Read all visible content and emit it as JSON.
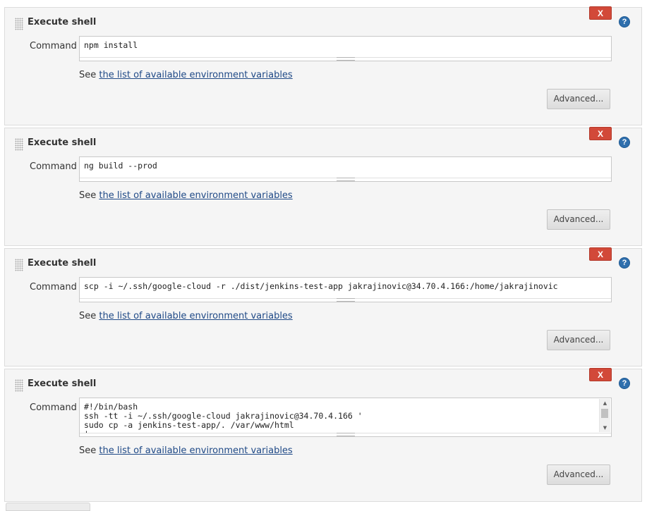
{
  "steps": [
    {
      "title": "Execute shell",
      "delete_label": "X",
      "help_label": "?",
      "command_label": "Command",
      "command_value": "npm install",
      "see_text": "See ",
      "env_link": "the list of available environment variables",
      "advanced_label": "Advanced..."
    },
    {
      "title": "Execute shell",
      "delete_label": "X",
      "help_label": "?",
      "command_label": "Command",
      "command_value": "ng build --prod",
      "see_text": "See ",
      "env_link": "the list of available environment variables",
      "advanced_label": "Advanced..."
    },
    {
      "title": "Execute shell",
      "delete_label": "X",
      "help_label": "?",
      "command_label": "Command",
      "command_value": "scp -i ~/.ssh/google-cloud -r ./dist/jenkins-test-app jakrajinovic@34.70.4.166:/home/jakrajinovic",
      "see_text": "See ",
      "env_link": "the list of available environment variables",
      "advanced_label": "Advanced..."
    },
    {
      "title": "Execute shell",
      "delete_label": "X",
      "help_label": "?",
      "command_label": "Command",
      "command_value": "#!/bin/bash\nssh -tt -i ~/.ssh/google-cloud jakrajinovic@34.70.4.166 '\nsudo cp -a jenkins-test-app/. /var/www/html\n'",
      "see_text": "See ",
      "env_link": "the list of available environment variables",
      "advanced_label": "Advanced..."
    }
  ],
  "colors": {
    "delete": "#d24939",
    "help": "#2f6fad",
    "link": "#204a87",
    "panel": "#f5f5f5"
  },
  "icons": {
    "delete": "close-icon",
    "help": "help-icon",
    "handle": "drag-handle-icon"
  }
}
